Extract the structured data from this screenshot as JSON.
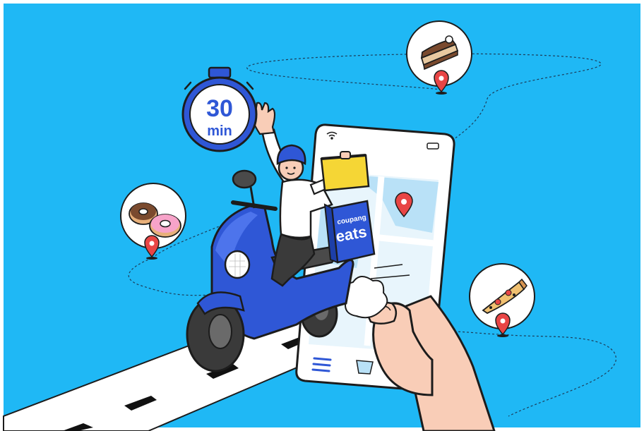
{
  "colors": {
    "background": "#1fb8f5",
    "frame": "#ffffff",
    "outline": "#1c1c1c",
    "scooter_blue": "#2f57d6",
    "pin_red": "#e84545",
    "map_water": "#b9e1f7",
    "box_yellow": "#f5d635",
    "skin": "#f9cdb7"
  },
  "timer": {
    "number": "30",
    "unit": "min"
  },
  "delivery_box": {
    "brand_small": "coupang",
    "brand_large": "eats"
  },
  "icons": [
    "stopwatch-icon",
    "cake-slice-icon",
    "donuts-icon",
    "pizza-slice-icon",
    "location-pin-icon",
    "wifi-icon",
    "battery-icon",
    "menu-icon",
    "basket-icon"
  ]
}
